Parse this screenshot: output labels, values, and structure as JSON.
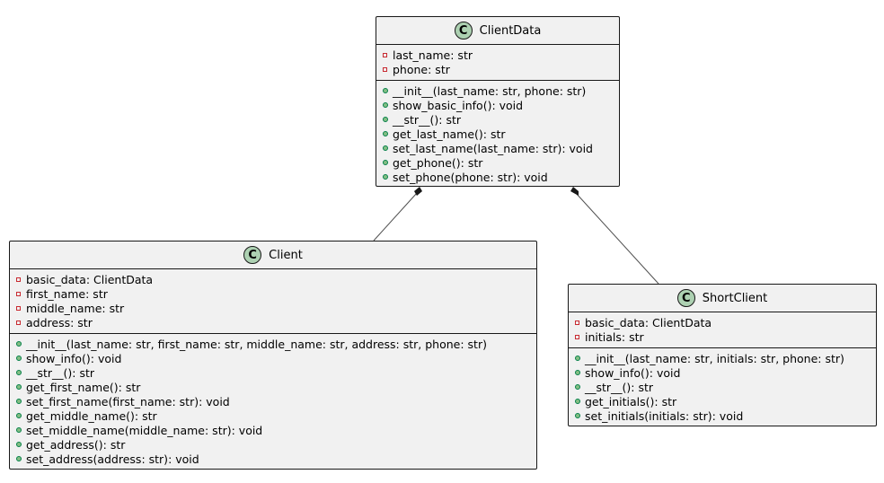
{
  "classes": {
    "clientdata": {
      "badge": "C",
      "name": "ClientData",
      "fields": [
        "last_name: str",
        "phone: str"
      ],
      "methods": [
        "__init__(last_name: str, phone: str)",
        "show_basic_info(): void",
        "__str__(): str",
        "get_last_name(): str",
        "set_last_name(last_name: str): void",
        "get_phone(): str",
        "set_phone(phone: str): void"
      ]
    },
    "client": {
      "badge": "C",
      "name": "Client",
      "fields": [
        "basic_data: ClientData",
        "first_name: str",
        "middle_name: str",
        "address: str"
      ],
      "methods": [
        "__init__(last_name: str, first_name: str, middle_name: str, address: str, phone: str)",
        "show_info(): void",
        "__str__(): str",
        "get_first_name(): str",
        "set_first_name(first_name: str): void",
        "get_middle_name(): str",
        "set_middle_name(middle_name: str): void",
        "get_address(): str",
        "set_address(address: str): void"
      ]
    },
    "shortclient": {
      "badge": "C",
      "name": "ShortClient",
      "fields": [
        "basic_data: ClientData",
        "initials: str"
      ],
      "methods": [
        "__init__(last_name: str, initials: str, phone: str)",
        "show_info(): void",
        "__str__(): str",
        "get_initials(): str",
        "set_initials(initials: str): void"
      ]
    }
  },
  "relations": [
    {
      "from": "ClientData",
      "to": "Client",
      "type": "composition"
    },
    {
      "from": "ClientData",
      "to": "ShortClient",
      "type": "composition"
    }
  ],
  "colors": {
    "class_fill": "#f1f1f1",
    "border": "#181818",
    "badge_fill": "#add1b2",
    "private_marker": "#c82930",
    "public_marker": "#84be84",
    "connector": "#4f4f4f"
  }
}
